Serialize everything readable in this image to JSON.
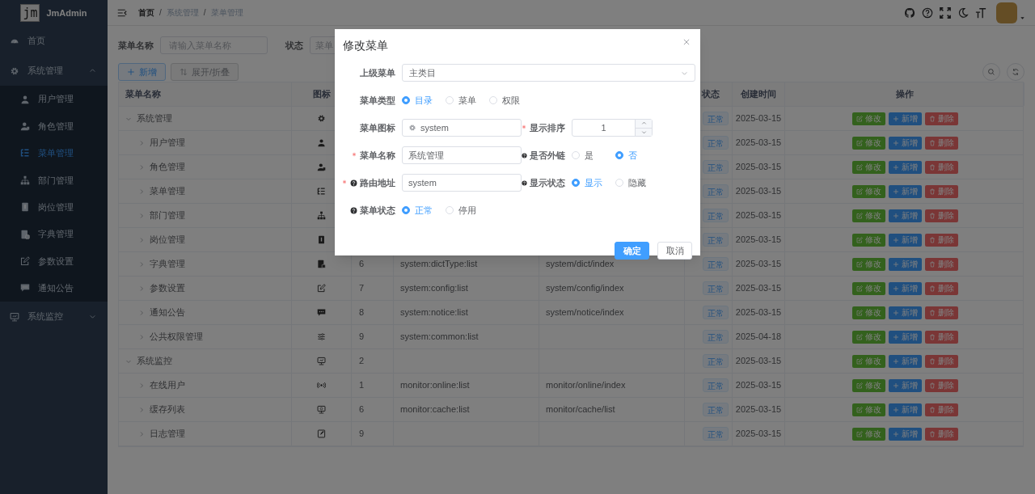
{
  "sidebar": {
    "logo": "jm",
    "app_name": "JmAdmin",
    "items": [
      {
        "label": "首页",
        "kind": "dashboard",
        "selected": false
      },
      {
        "label": "系统管理",
        "kind": "gear",
        "selected": false,
        "expanded": true,
        "children": [
          {
            "label": "用户管理",
            "kind": "user",
            "selected": false
          },
          {
            "label": "角色管理",
            "kind": "role",
            "selected": false
          },
          {
            "label": "菜单管理",
            "kind": "tree",
            "selected": true
          },
          {
            "label": "部门管理",
            "kind": "sitemap",
            "selected": false
          },
          {
            "label": "岗位管理",
            "kind": "post",
            "selected": false
          },
          {
            "label": "字典管理",
            "kind": "dict",
            "selected": false
          },
          {
            "label": "参数设置",
            "kind": "edit",
            "selected": false
          },
          {
            "label": "通知公告",
            "kind": "message",
            "selected": false
          }
        ]
      },
      {
        "label": "系统监控",
        "kind": "monitor",
        "selected": false,
        "expanded": false
      }
    ]
  },
  "header": {
    "breadcrumb": [
      "首页",
      "系统管理",
      "菜单管理"
    ],
    "separators": [
      "/",
      "/"
    ]
  },
  "search": {
    "fields": [
      {
        "label": "菜单名称",
        "placeholder": "请输入菜单名称"
      },
      {
        "label": "状态",
        "placeholder": "菜单"
      }
    ]
  },
  "toolbar": {
    "buttons": [
      {
        "kind": "primary",
        "label": "新增"
      },
      {
        "kind": "default",
        "label": "展开/折叠"
      }
    ]
  },
  "table": {
    "columns": [
      "菜单名称",
      "图标",
      "状态",
      "创建时间",
      "操作"
    ],
    "rows": [
      {
        "name": "系统管理",
        "kind": "gear",
        "expanded": true,
        "status": "正常",
        "created": "2025-03-15",
        "actions": [
          "修改",
          "新增",
          "删除"
        ],
        "children": [
          {
            "name": "用户管理",
            "kind": "user",
            "expanded": false,
            "status": "正常",
            "created": "2025-03-15",
            "actions": [
              "修改",
              "新增",
              "删除"
            ]
          },
          {
            "name": "角色管理",
            "kind": "role",
            "expanded": false,
            "status": "正常",
            "created": "2025-03-15",
            "actions": [
              "修改",
              "新增",
              "删除"
            ]
          },
          {
            "name": "菜单管理",
            "kind": "tree",
            "expanded": false,
            "status": "正常",
            "created": "2025-03-15",
            "actions": [
              "修改",
              "新增",
              "删除"
            ]
          },
          {
            "name": "部门管理",
            "kind": "sitemap",
            "expanded": false,
            "status": "正常",
            "created": "2025-03-15",
            "actions": [
              "修改",
              "新增",
              "删除"
            ]
          },
          {
            "name": "岗位管理",
            "kind": "post",
            "expanded": false,
            "status": "正常",
            "created": "2025-03-15",
            "actions": [
              "修改",
              "新增",
              "删除"
            ]
          },
          {
            "name": "字典管理",
            "kind": "dict",
            "expanded": false,
            "order": "6",
            "perms": "system:dictType:list",
            "component": "system/dict/index",
            "status": "正常",
            "created": "2025-03-15",
            "actions": [
              "修改",
              "新增",
              "删除"
            ]
          },
          {
            "name": "参数设置",
            "kind": "edit",
            "expanded": false,
            "order": "7",
            "perms": "system:config:list",
            "component": "system/config/index",
            "status": "正常",
            "created": "2025-03-15",
            "actions": [
              "修改",
              "新增",
              "删除"
            ]
          },
          {
            "name": "通知公告",
            "kind": "message",
            "expanded": false,
            "order": "8",
            "perms": "system:notice:list",
            "component": "system/notice/index",
            "status": "正常",
            "created": "2025-03-15",
            "actions": [
              "修改",
              "新增",
              "删除"
            ]
          },
          {
            "name": "公共权限管理",
            "kind": "sliders",
            "expanded": false,
            "order": "9",
            "perms": "system:common:list",
            "status": "正常",
            "created": "2025-04-18",
            "actions": [
              "修改",
              "新增",
              "删除"
            ]
          }
        ]
      },
      {
        "name": "系统监控",
        "kind": "monitor",
        "expanded": true,
        "order": "2",
        "status": "正常",
        "created": "2025-03-15",
        "actions": [
          "修改",
          "新增",
          "删除"
        ],
        "children": [
          {
            "name": "在线用户",
            "kind": "online",
            "expanded": false,
            "order": "1",
            "perms": "monitor:online:list",
            "component": "monitor/online/index",
            "status": "正常",
            "created": "2025-03-15",
            "actions": [
              "修改",
              "新增",
              "删除"
            ]
          },
          {
            "name": "缓存列表",
            "kind": "cache",
            "expanded": false,
            "order": "6",
            "perms": "monitor:cache:list",
            "component": "monitor/cache/list",
            "status": "正常",
            "created": "2025-03-15",
            "actions": [
              "修改",
              "新增",
              "删除"
            ]
          },
          {
            "name": "日志管理",
            "kind": "log",
            "expanded": false,
            "order": "9",
            "status": "正常",
            "created": "2025-03-15",
            "actions": [
              "修改",
              "新增",
              "删除"
            ]
          }
        ]
      }
    ]
  },
  "dialog": {
    "title": "修改菜单",
    "rows": [
      [
        {
          "kind": "select",
          "label": "上级菜单",
          "required": false,
          "help": false,
          "value": "主类目"
        }
      ],
      [
        {
          "kind": "radio",
          "label": "菜单类型",
          "required": false,
          "help": false,
          "options": [
            {
              "label": "目录",
              "selected": true
            },
            {
              "label": "菜单",
              "selected": false
            },
            {
              "label": "权限",
              "selected": false
            }
          ]
        }
      ],
      [
        {
          "kind": "icon-input",
          "label": "菜单图标",
          "required": false,
          "help": false,
          "value": "system"
        },
        {
          "kind": "number",
          "label": "显示排序",
          "required": true,
          "help": false,
          "value": "1"
        }
      ],
      [
        {
          "kind": "input",
          "label": "菜单名称",
          "required": true,
          "help": false,
          "value": "系统管理"
        },
        {
          "kind": "radio",
          "label": "是否外链",
          "required": false,
          "help": true,
          "options": [
            {
              "label": "是",
              "selected": false
            },
            {
              "label": "否",
              "selected": true
            }
          ]
        }
      ],
      [
        {
          "kind": "input",
          "label": "路由地址",
          "required": true,
          "help": true,
          "value": "system"
        },
        {
          "kind": "radio",
          "label": "显示状态",
          "required": false,
          "help": true,
          "options": [
            {
              "label": "显示",
              "selected": true
            },
            {
              "label": "隐藏",
              "selected": false
            }
          ]
        }
      ],
      [
        {
          "kind": "radio",
          "label": "菜单状态",
          "required": false,
          "help": true,
          "options": [
            {
              "label": "正常",
              "selected": true
            },
            {
              "label": "停用",
              "selected": false
            }
          ]
        }
      ]
    ],
    "buttons": [
      {
        "kind": "primary",
        "label": "确定"
      },
      {
        "kind": "default",
        "label": "取消"
      }
    ]
  }
}
